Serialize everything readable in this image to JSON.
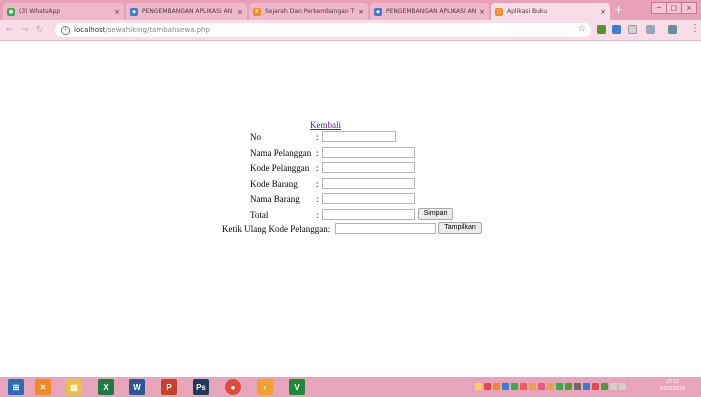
{
  "browser": {
    "tabs": [
      {
        "title": "(3) WhatsApp",
        "favicon_color": "#2fb24a"
      },
      {
        "title": "PENGEMBANGAN APLIKASI AN",
        "favicon_color": "#3b7bd4"
      },
      {
        "title": "Sejarah Dan Perkembangan Tv",
        "favicon_color": "#f28c1c"
      },
      {
        "title": "PENGEMBANGAN APLIKASI AN",
        "favicon_color": "#3b7bd4"
      },
      {
        "title": "Aplikasi Buku",
        "favicon_color": "#f28c1c"
      }
    ],
    "active_tab": 4,
    "close_glyph": "×",
    "new_tab_glyph": "+",
    "url_host": "localhost",
    "url_path": "/sewahiking/tambahsewa.php",
    "window_controls": [
      "─",
      "□",
      "×"
    ]
  },
  "form": {
    "back_link": "Kembali",
    "colon": ":",
    "fields": [
      {
        "label": "No",
        "value": ""
      },
      {
        "label": "Nama Pelanggan",
        "value": ""
      },
      {
        "label": "Kode Pelanggan",
        "value": ""
      },
      {
        "label": "Kode Barang",
        "value": ""
      },
      {
        "label": "Nama Barang",
        "value": ""
      },
      {
        "label": "Total",
        "value": ""
      }
    ],
    "save_button": "Simpan",
    "retype_label": "Ketik Ulang Kode Pelanggan:",
    "retype_value": "",
    "show_button": "Tampilkan"
  },
  "taskbar": {
    "apps": [
      {
        "name": "start",
        "glyph": "⊞",
        "color": "#2a6fb5"
      },
      {
        "name": "xampp",
        "glyph": "✕",
        "color": "#f08a24"
      },
      {
        "name": "file-explorer",
        "glyph": "▤",
        "color": "#e8c14a"
      },
      {
        "name": "excel",
        "glyph": "X",
        "color": "#1f7a43"
      },
      {
        "name": "word",
        "glyph": "W",
        "color": "#2b5797"
      },
      {
        "name": "powerpoint",
        "glyph": "P",
        "color": "#c6412b"
      },
      {
        "name": "photoshop",
        "glyph": "Ps",
        "color": "#1b3a5c"
      },
      {
        "name": "chrome",
        "glyph": "●",
        "color": "#dd4b39"
      },
      {
        "name": "headset",
        "glyph": "◗",
        "color": "#f2a12c"
      },
      {
        "name": "vim",
        "glyph": "V",
        "color": "#1d8a3b"
      }
    ],
    "clock_time": "23:12",
    "clock_date": "01/02/2019"
  }
}
